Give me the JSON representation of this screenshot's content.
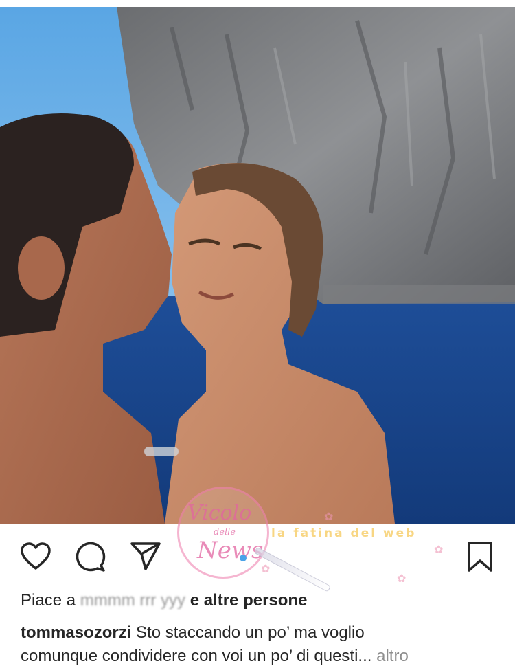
{
  "post": {
    "username": "tommasozorzi",
    "caption_line1": "Sto staccando un po’ ma voglio",
    "caption_line2": "comunque condividere con voi un po’ di questi...",
    "more_label": "altro",
    "likes_prefix": "Piace a",
    "likes_obscured_name": "mmmm rrr yyy",
    "likes_suffix": "e altre persone"
  },
  "actions": {
    "like": "heart-icon",
    "comment": "comment-icon",
    "share": "send-icon",
    "save": "bookmark-icon"
  },
  "watermarks": {
    "stamp_line1": "Vicolo",
    "stamp_line2": "delle",
    "stamp_line3": "News",
    "banner": "la fatina del web"
  },
  "colors": {
    "text": "#262626",
    "muted": "#8e8e8e",
    "sea": "#1f4f96",
    "sky": "#6fb3e6"
  }
}
